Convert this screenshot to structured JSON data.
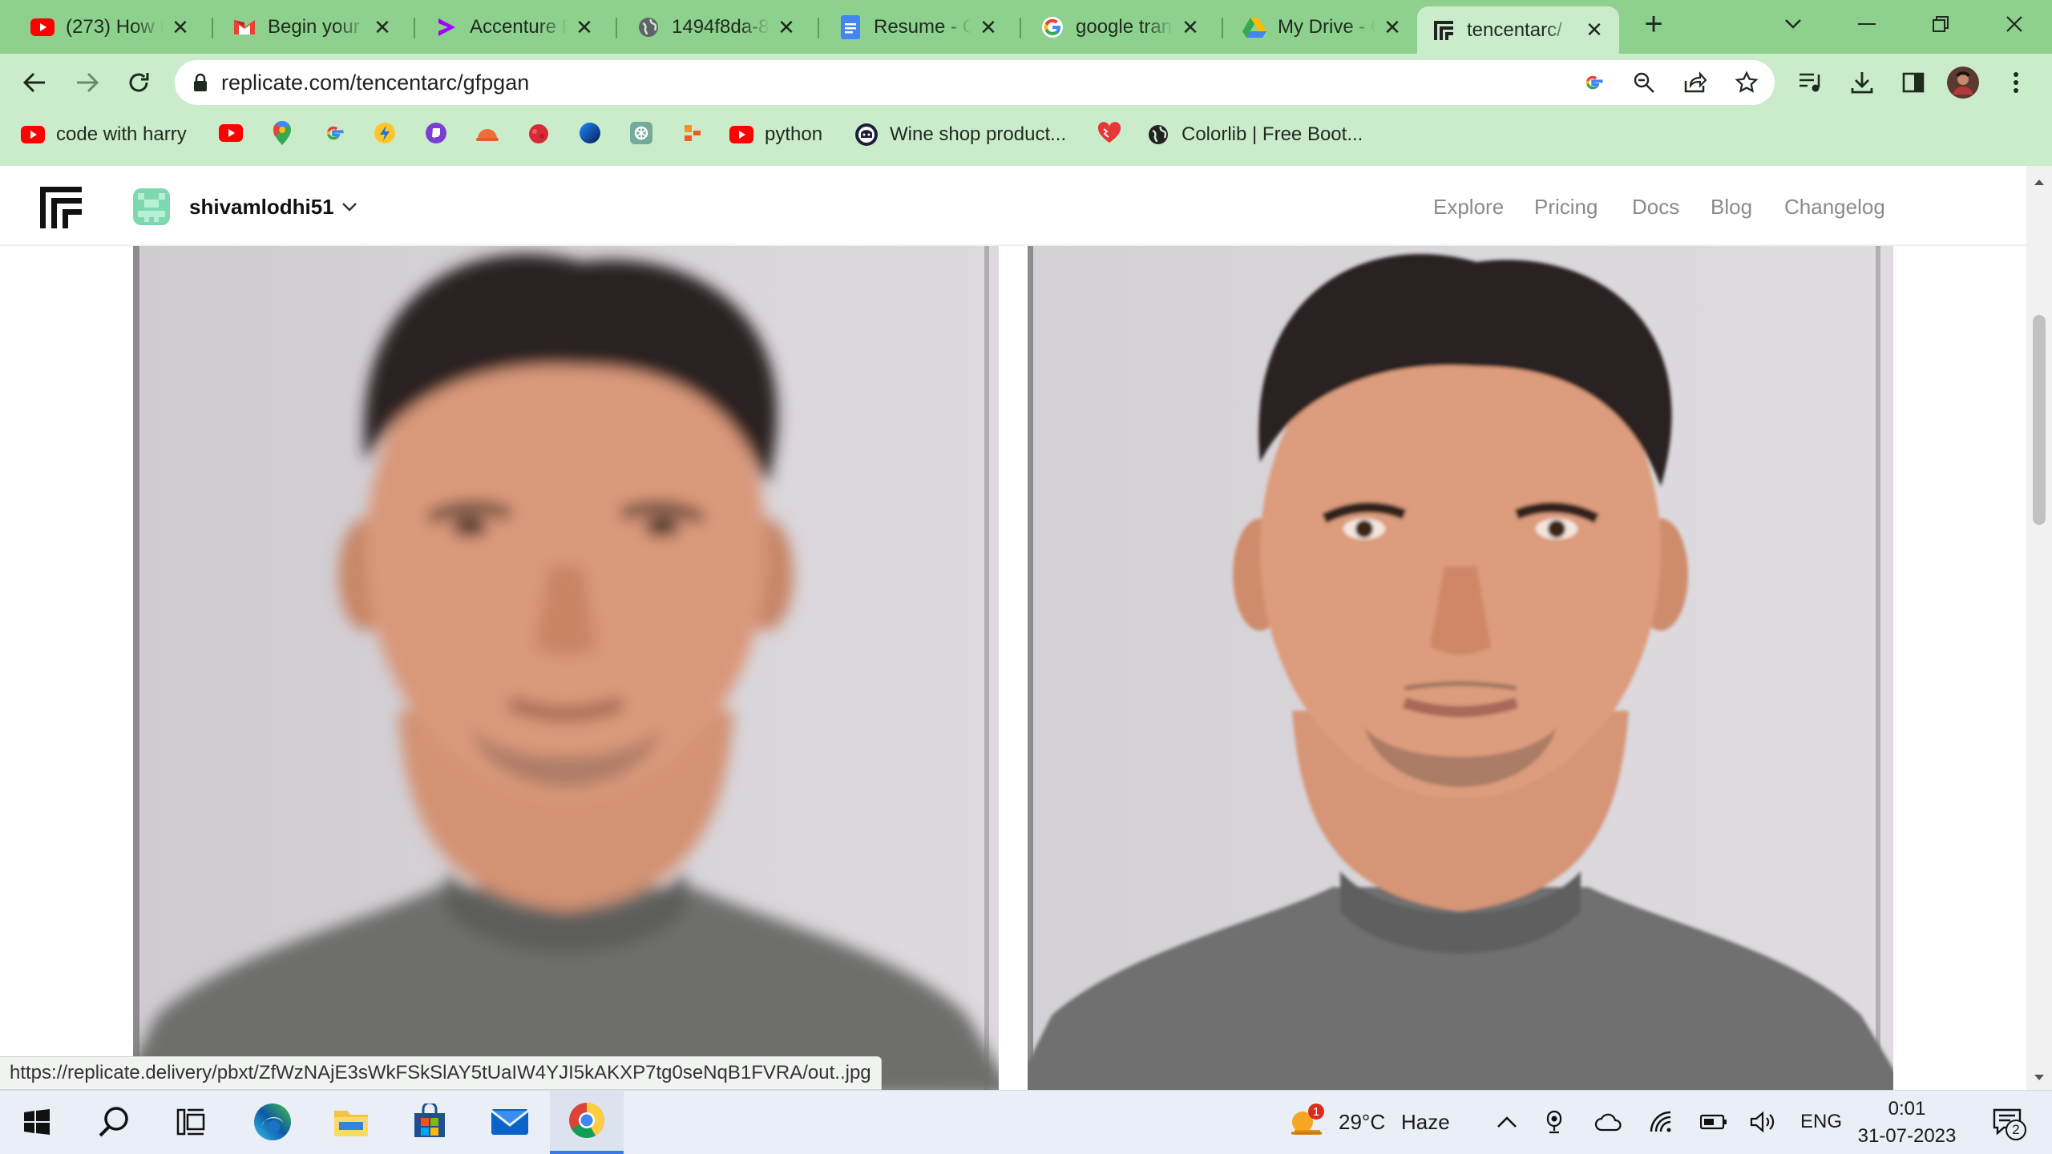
{
  "browser": {
    "tabs": [
      {
        "title": "(273) How to",
        "icon": "youtube-icon"
      },
      {
        "title": "Begin your J",
        "icon": "gmail-icon"
      },
      {
        "title": "Accenture F",
        "icon": "accenture-icon"
      },
      {
        "title": "1494f8da-8",
        "icon": "globe-icon"
      },
      {
        "title": "Resume - G",
        "icon": "docs-icon"
      },
      {
        "title": "google tran",
        "icon": "google-icon"
      },
      {
        "title": "My Drive - G",
        "icon": "drive-icon"
      },
      {
        "title": "tencentarc/",
        "icon": "replicate-icon",
        "active": true
      }
    ],
    "url": "replicate.com/tencentarc/gfpgan",
    "bookmarks": {
      "code_with_harry": "code with harry",
      "python": "python",
      "wine_shop": "Wine shop product...",
      "colorlib": "Colorlib | Free Boot..."
    },
    "status_url": "https://replicate.delivery/pbxt/ZfWzNAjE3sWkFSkSlAY5tUaIW4YJI5kAKXP7tg0seNqB1FVRA/out..jpg"
  },
  "site": {
    "username": "shivamlodhi51",
    "nav": [
      "Explore",
      "Pricing",
      "Docs",
      "Blog",
      "Changelog"
    ]
  },
  "taskbar": {
    "weather": {
      "temp": "29°C",
      "condition": "Haze",
      "badge": "1"
    },
    "language": "ENG",
    "time": "0:01",
    "date": "31-07-2023",
    "notifications": "2"
  },
  "colors": {
    "tabstrip": "#8ed08e",
    "toolbar": "#cbeccb",
    "accent_green": "#3aa655"
  }
}
